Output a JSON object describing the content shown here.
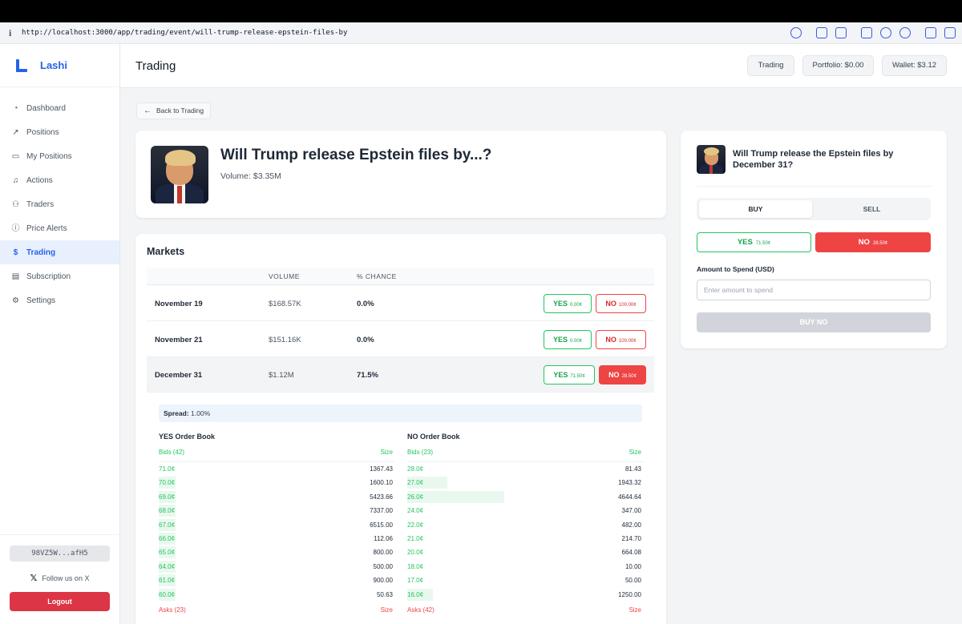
{
  "browser": {
    "url": "http://localhost:3000/app/trading/event/will-trump-release-epstein-files-by"
  },
  "sidebar": {
    "brand": "Lashi",
    "items": [
      {
        "label": "Dashboard",
        "icon": "dashboard-icon"
      },
      {
        "label": "Positions",
        "icon": "trend-icon"
      },
      {
        "label": "My Positions",
        "icon": "briefcase-icon"
      },
      {
        "label": "Actions",
        "icon": "bell-icon"
      },
      {
        "label": "Traders",
        "icon": "users-icon"
      },
      {
        "label": "Price Alerts",
        "icon": "alert-icon"
      },
      {
        "label": "Trading",
        "icon": "dollar-icon",
        "active": true
      },
      {
        "label": "Subscription",
        "icon": "card-icon"
      },
      {
        "label": "Settings",
        "icon": "gear-icon"
      }
    ],
    "wallet_address": "98VZ5W...afH5",
    "follow": "Follow us on X",
    "logout": "Logout"
  },
  "header": {
    "title": "Trading",
    "trading_btn": "Trading",
    "portfolio_btn": "Portfolio: $0.00",
    "wallet_btn": "Wallet: $3.12"
  },
  "back_button": "Back to Trading",
  "event": {
    "title": "Will Trump release Epstein files by...?",
    "volume": "Volume: $3.35M"
  },
  "markets": {
    "title": "Markets",
    "columns": {
      "volume": "VOLUME",
      "chance": "% CHANCE"
    },
    "rows": [
      {
        "date": "November 19",
        "volume": "$168.57K",
        "chance": "0.0%",
        "yes": "YES",
        "yes_price": "0.00¢",
        "no": "NO",
        "no_price": "100.00¢"
      },
      {
        "date": "November 21",
        "volume": "$151.16K",
        "chance": "0.0%",
        "yes": "YES",
        "yes_price": "0.00¢",
        "no": "NO",
        "no_price": "100.00¢"
      },
      {
        "date": "December 31",
        "volume": "$1.12M",
        "chance": "71.5%",
        "yes": "YES",
        "yes_price": "71.50¢",
        "no": "NO",
        "no_price": "28.50¢"
      }
    ]
  },
  "orderbook": {
    "spread_label": "Spread:",
    "spread_value": "1.00%",
    "yes": {
      "title": "YES Order Book",
      "bids_label": "Bids (42)",
      "size_label": "Size",
      "asks_label": "Asks (23)",
      "rows": [
        {
          "price": "71.0¢",
          "size": "1367.43",
          "fill": 0.0
        },
        {
          "price": "70.0¢",
          "size": "1600.10",
          "fill": 0.07
        },
        {
          "price": "69.0¢",
          "size": "5423.66",
          "fill": 0.07
        },
        {
          "price": "68.0¢",
          "size": "7337.00",
          "fill": 0.07
        },
        {
          "price": "67.0¢",
          "size": "6515.00",
          "fill": 0.07
        },
        {
          "price": "66.0¢",
          "size": "112.06",
          "fill": 0.07
        },
        {
          "price": "65.0¢",
          "size": "800.00",
          "fill": 0.07
        },
        {
          "price": "64.0¢",
          "size": "500.00",
          "fill": 0.07
        },
        {
          "price": "61.0¢",
          "size": "900.00",
          "fill": 0.07
        },
        {
          "price": "60.0¢",
          "size": "50.63",
          "fill": 0.07
        }
      ]
    },
    "no": {
      "title": "NO Order Book",
      "bids_label": "Bids (23)",
      "size_label": "Size",
      "asks_label": "Asks (42)",
      "rows": [
        {
          "price": "28.0¢",
          "size": "81.43",
          "fill": 0.0
        },
        {
          "price": "27.0¢",
          "size": "1943.32",
          "fill": 0.17
        },
        {
          "price": "26.0¢",
          "size": "4644.64",
          "fill": 0.41
        },
        {
          "price": "24.0¢",
          "size": "347.00",
          "fill": 0.0
        },
        {
          "price": "22.0¢",
          "size": "482.00",
          "fill": 0.0
        },
        {
          "price": "21.0¢",
          "size": "214.70",
          "fill": 0.0
        },
        {
          "price": "20.0¢",
          "size": "664.08",
          "fill": 0.0
        },
        {
          "price": "18.0¢",
          "size": "10.00",
          "fill": 0.0
        },
        {
          "price": "17.0¢",
          "size": "50.00",
          "fill": 0.0
        },
        {
          "price": "16.0¢",
          "size": "1250.00",
          "fill": 0.11
        }
      ]
    }
  },
  "trade": {
    "title": "Will Trump release the Epstein files by December 31?",
    "buy_tab": "BUY",
    "sell_tab": "SELL",
    "yes": "YES",
    "yes_price": "71.50¢",
    "no": "NO",
    "no_price": "28.50¢",
    "amount_label": "Amount to Spend (USD)",
    "amount_placeholder": "Enter amount to spend",
    "submit": "BUY NO"
  }
}
